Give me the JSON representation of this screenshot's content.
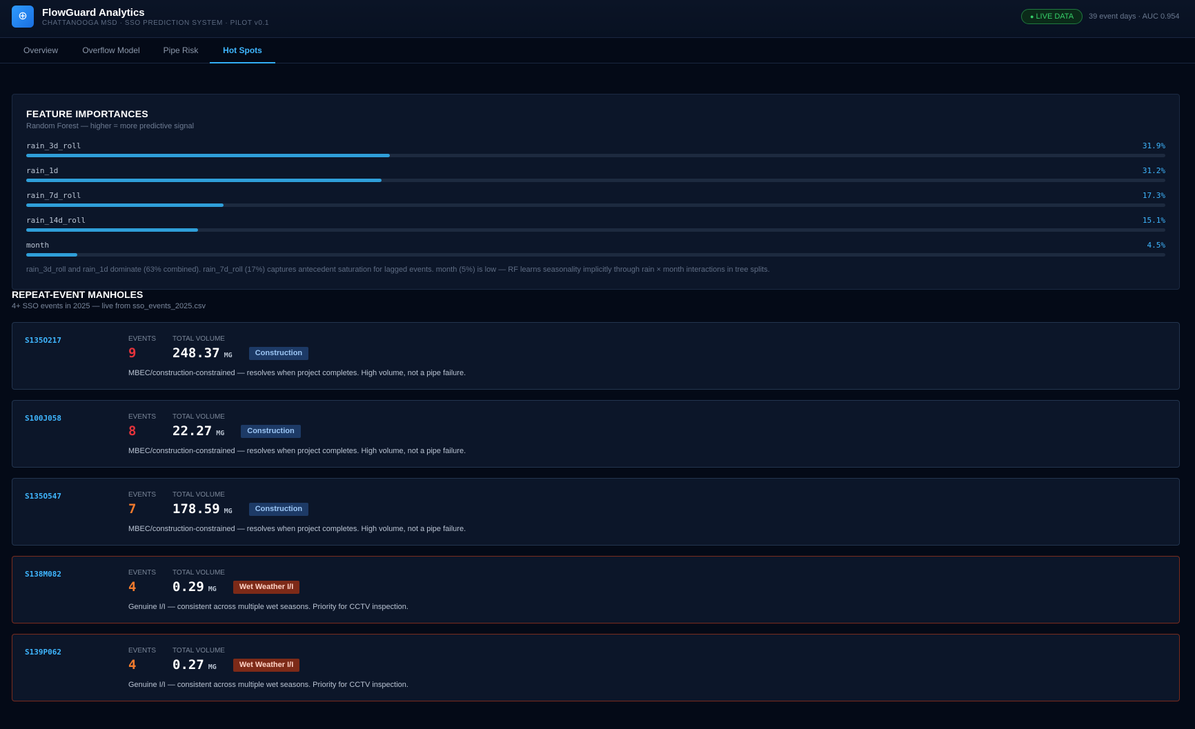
{
  "header": {
    "logo_glyph": "⊕",
    "title": "FlowGuard Analytics",
    "subtitle": "CHATTANOOGA MSD · SSO PREDICTION SYSTEM · PILOT v0.1",
    "live_badge": "LIVE DATA",
    "live_dot": "●",
    "stats": "39 event days · AUC 0.954"
  },
  "tabs": [
    {
      "label": "Overview",
      "active": false
    },
    {
      "label": "Overflow Model",
      "active": false
    },
    {
      "label": "Pipe Risk",
      "active": false
    },
    {
      "label": "Hot Spots",
      "active": true
    }
  ],
  "feature_importances": {
    "title": "FEATURE IMPORTANCES",
    "subtitle": "Random Forest — higher = more predictive signal",
    "items": [
      {
        "name": "rain_3d_roll",
        "pct_label": "31.9%",
        "value": 31.9
      },
      {
        "name": "rain_1d",
        "pct_label": "31.2%",
        "value": 31.2
      },
      {
        "name": "rain_7d_roll",
        "pct_label": "17.3%",
        "value": 17.3
      },
      {
        "name": "rain_14d_roll",
        "pct_label": "15.1%",
        "value": 15.1
      },
      {
        "name": "month",
        "pct_label": "4.5%",
        "value": 4.5
      }
    ],
    "note": "rain_3d_roll and rain_1d dominate (63% combined). rain_7d_roll (17%) captures antecedent saturation for lagged events. month (5%) is low — RF learns seasonality implicitly through rain × month interactions in tree splits."
  },
  "repeat": {
    "title": "REPEAT-EVENT MANHOLES",
    "subtitle": "4+ SSO events in 2025 — live from sso_events_2025.csv",
    "events_label": "EVENTS",
    "volume_label": "TOTAL VOLUME",
    "unit": "MG",
    "manholes": [
      {
        "id": "S135O217",
        "events": "9",
        "events_color": "#e5333b",
        "volume": "248.37",
        "tag": "Construction",
        "tag_kind": "construction",
        "desc": "MBEC/construction-constrained — resolves when project completes. High volume, not a pipe failure."
      },
      {
        "id": "S100J058",
        "events": "8",
        "events_color": "#e5333b",
        "volume": "22.27",
        "tag": "Construction",
        "tag_kind": "construction",
        "desc": "MBEC/construction-constrained — resolves when project completes. High volume, not a pipe failure."
      },
      {
        "id": "S135O547",
        "events": "7",
        "events_color": "#f07a2d",
        "volume": "178.59",
        "tag": "Construction",
        "tag_kind": "construction",
        "desc": "MBEC/construction-constrained — resolves when project completes. High volume, not a pipe failure."
      },
      {
        "id": "S138M082",
        "events": "4",
        "events_color": "#f07a2d",
        "volume": "0.29",
        "tag": "Wet Weather I/I",
        "tag_kind": "wet",
        "desc": "Genuine I/I — consistent across multiple wet seasons. Priority for CCTV inspection."
      },
      {
        "id": "S139P062",
        "events": "4",
        "events_color": "#f07a2d",
        "volume": "0.27",
        "tag": "Wet Weather I/I",
        "tag_kind": "wet",
        "desc": "Genuine I/I — consistent across multiple wet seasons. Priority for CCTV inspection."
      }
    ]
  },
  "colors": {
    "accent": "#3fb6ff",
    "bar": "#2f9fd9",
    "live_green": "#36d06a",
    "construction_tag": "#1d3a66",
    "wet_tag": "#7d2a18"
  }
}
